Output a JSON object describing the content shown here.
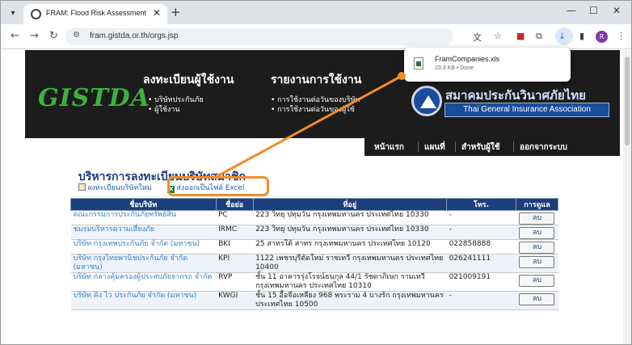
{
  "browser": {
    "tab_title": "FRAM: Flood Risk Assessment",
    "url": "fram.gistda.or.th/orgs.jsp",
    "profile_initial": "R"
  },
  "download": {
    "filename": "FramCompanies.xls",
    "meta": "23.3 KB • Done"
  },
  "banner": {
    "logo": "GISTDA",
    "menu1_title": "ลงทะเบียนผู้ใช้งาน",
    "menu1_items": [
      "บริษัทประกันภัย",
      "ผู้ใช้งาน"
    ],
    "menu2_title": "รายงานการใช้งาน",
    "menu2_items": [
      "การใช้งานต่อวันของบริษัท",
      "การใช้งานต่อวันของผู้ใช้"
    ],
    "tgia_thai": "สมาคมประกันวินาศภัยไทย",
    "tgia_en": "Thai General Insurance Association"
  },
  "nav": [
    "หน้าแรก",
    "แผนที่",
    "สำหรับผู้ใช้",
    "ออกจากระบบ"
  ],
  "page": {
    "heading": "บริหารการลงทะเบียนบริษัทสมาชิก",
    "register_link": "ลงทะเบียนบริษัทใหม่",
    "export_link": "ส่งออกเป็นไฟล์ Excel"
  },
  "table": {
    "headers": [
      "ชื่อบริษัท",
      "ชื่อย่อ",
      "ที่อยู่",
      "โทร.",
      "การดูแล"
    ],
    "delete_label": "ลบ",
    "rows": [
      {
        "name": "คณะกรรมการประกันภัยทรัพย์สิน",
        "code": "PC",
        "addr": "223 วิทยุ ปทุมวัน กรุงเทพมหานคร ประเทศไทย 10330",
        "tel": "-"
      },
      {
        "name": "ชมรมบริหารความเสี่ยงภัย",
        "code": "IRMC",
        "addr": "223 วิทยุ ปทุมวัน กรุงเทพมหานคร ประเทศไทย 10330",
        "tel": "-"
      },
      {
        "name": "บริษัท กรุงเทพประกันภัย จำกัด (มหาชน)",
        "code": "BKI",
        "addr": "25 สาทรใต้ สาทร กรุงเทพมหานคร ประเทศไทย 10120",
        "tel": "022858888"
      },
      {
        "name": "บริษัท กรุงไทยพานิชประกันภัย จำกัด (มหาชน)",
        "code": "KPI",
        "addr": "1122 เพชรบุรีตัดใหม่ ราชเทวี กรุงเทพมหานคร ประเทศไทย 10400",
        "tel": "026241111"
      },
      {
        "name": "บริษัท กลางคุ้มครองผู้ประสบภัยจากรถ จำกัด",
        "code": "RVP",
        "addr": "ชั้น 11 อาคารรุ่งโรจน์ธนกุล 44/1 รัชดาภิเษก รามเทวี กรุงเทพมหานคร ประเทศไทย 10310",
        "tel": "021009191"
      },
      {
        "name": "บริษัท คิง ไว ประกันภัย จำกัด (มหาชน)",
        "code": "KWGI",
        "addr": "ชั้น 15 อื้อจือเหลียง 968 พระราม 4 บางรัก กรุงเทพมหานคร ประเทศไทย 10500",
        "tel": "-"
      }
    ]
  }
}
